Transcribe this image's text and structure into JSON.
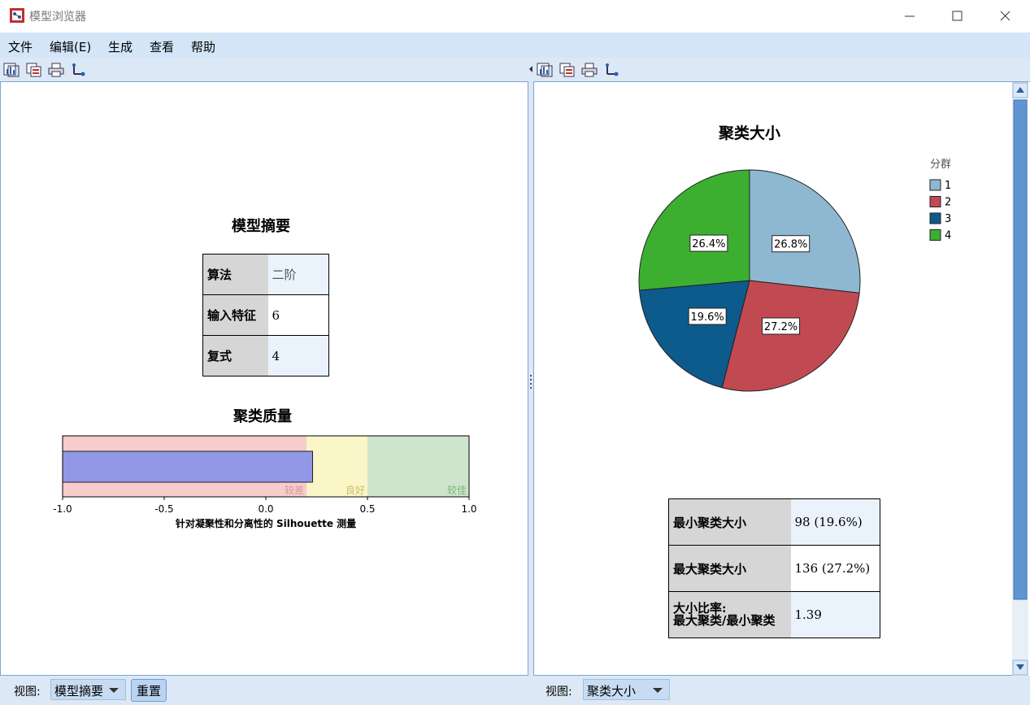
{
  "window": {
    "title": "模型浏览器"
  },
  "menu": {
    "items": [
      "文件",
      "编辑(E)",
      "生成",
      "查看",
      "帮助"
    ]
  },
  "toolbar_icons": [
    "chart-icon",
    "copy-icon",
    "print-icon",
    "tree-icon"
  ],
  "left_panel": {
    "summary_title": "模型摘要",
    "summary_rows": [
      {
        "label": "算法",
        "value": "二阶"
      },
      {
        "label": "输入特征",
        "value": "6"
      },
      {
        "label": "复式",
        "value": "4"
      }
    ],
    "quality_title": "聚类质量",
    "quality_chart": {
      "type": "bar",
      "xlabel": "针对凝聚性和分离性的 Silhouette 测量",
      "xlim": [
        -1.0,
        1.0
      ],
      "ticks": [
        "-1.0",
        "-0.5",
        "0.0",
        "0.5",
        "1.0"
      ],
      "value": 0.23,
      "bands": [
        {
          "label": "较差",
          "from": -1.0,
          "to": 0.2,
          "color": "#f7cccc",
          "label_color": "#d89a9a"
        },
        {
          "label": "良好",
          "from": 0.2,
          "to": 0.5,
          "color": "#fbf6c8",
          "label_color": "#c8bd6a"
        },
        {
          "label": "较佳",
          "from": 0.5,
          "to": 1.0,
          "color": "#cfe4cc",
          "label_color": "#7fb47c"
        }
      ],
      "bar_color": "#9397e8"
    },
    "footer": {
      "view_label": "视图:",
      "view_value": "模型摘要",
      "reset_label": "重置"
    }
  },
  "right_panel": {
    "footer": {
      "view_label": "视图:",
      "view_value": "聚类大小"
    },
    "stats_rows": [
      {
        "label": "最小聚类大小",
        "value": "98 (19.6%)"
      },
      {
        "label": "最大聚类大小",
        "value": "136 (27.2%)"
      },
      {
        "label": "大小比率:\n最大聚类/最小聚类",
        "value": "1.39"
      }
    ]
  },
  "chart_data": {
    "type": "pie",
    "title": "聚类大小",
    "legend_title": "分群",
    "legend_position": "top-right",
    "slices": [
      {
        "name": "1",
        "value": 26.8,
        "label": "26.8%",
        "color": "#8eb8d1"
      },
      {
        "name": "2",
        "value": 27.2,
        "label": "27.2%",
        "color": "#c14a52"
      },
      {
        "name": "3",
        "value": 19.6,
        "label": "19.6%",
        "color": "#0d5a8c"
      },
      {
        "name": "4",
        "value": 26.4,
        "label": "26.4%",
        "color": "#3caf30"
      }
    ]
  }
}
